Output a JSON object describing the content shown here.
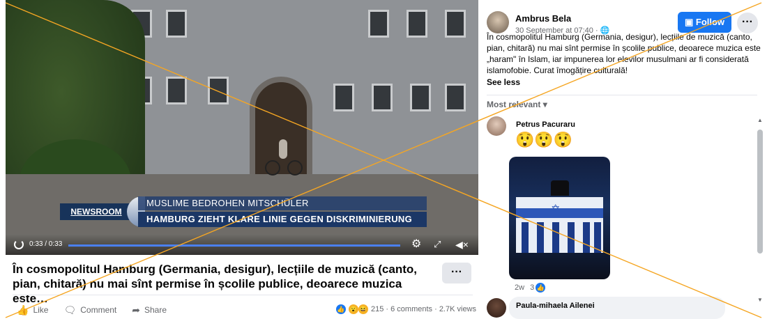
{
  "video": {
    "lower_third_brand": "NEWSROOM",
    "lower_third_top": "MUSLIME BEDROHEN MITSCHÜLER",
    "lower_third_bottom": "HAMBURG ZIEHT KLARE LINIE GEGEN DISKRIMINIERUNG",
    "time": "0:33 / 0:33",
    "progress": 1.0
  },
  "caption": "În cosmopolitul Hamburg (Germania, desigur), lecțiile de muzică (canto, pian, chitară) nu mai sînt permise în școlile publice, deoarece muzica este…",
  "actions": {
    "like": "Like",
    "comment": "Comment",
    "share": "Share",
    "stats": "215 · 6 comments · 2.7K views",
    "more": "···"
  },
  "post": {
    "author": "Ambrus Bela",
    "date": "30 September at 07:40 · ",
    "follow": "Follow",
    "more": "···",
    "text": "În cosmopolitul Hamburg (Germania, desigur), lecțiile de muzică (canto, pian, chitară) nu mai sînt permise în școlile publice, deoarece muzica este „haram\" în Islam, iar impunerea lor elevilor musulmani ar fi considerată islamofobie. Curat îmogățire culturală!",
    "see_less": "See less",
    "sort": "Most relevant"
  },
  "comments": [
    {
      "author": "Petrus Pacuraru",
      "emojis": "😲😲😲",
      "age": "2w",
      "reactions": "3"
    },
    {
      "author": "Paula-mihaela Ailenei"
    }
  ],
  "colors": {
    "accent": "#1877f2",
    "overlay_line": "#f5a623"
  }
}
